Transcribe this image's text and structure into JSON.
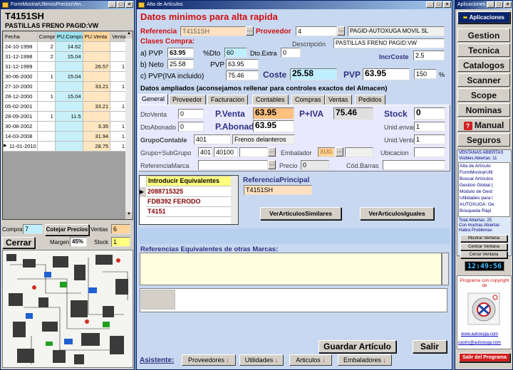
{
  "left": {
    "title": "FormMostrarUltimosPreciosVen...",
    "code": "T4151SH",
    "desc": "PASTILLAS FRENO PAGID:VW",
    "headers": [
      "Fecha",
      "Compr",
      "PU.Compra",
      "PU.Venta",
      "Venta"
    ],
    "rows": [
      [
        "24-10-1998",
        "2",
        "14.62",
        "",
        ""
      ],
      [
        "31-12-1998",
        "2",
        "15.04",
        "",
        ""
      ],
      [
        "31-12-1999",
        "",
        "",
        "26.57",
        "1"
      ],
      [
        "30-06-2000",
        "1",
        "15.04",
        "",
        ""
      ],
      [
        "27-10-2000",
        "",
        "",
        "33.21",
        "1"
      ],
      [
        "28-12-2000",
        "1",
        "15.04",
        "",
        ""
      ],
      [
        "05-02-2001",
        "",
        "",
        "33.21",
        "1"
      ],
      [
        "28-09-2001",
        "1",
        "11.5",
        "",
        ""
      ],
      [
        "30-08-2002",
        "",
        "",
        "3.35",
        "1"
      ],
      [
        "14-03-2008",
        "",
        "",
        "31.94",
        "1"
      ],
      [
        "11-01-2010",
        "",
        "",
        "28.75",
        "1"
      ]
    ],
    "compras_label": "Compras",
    "compras_val": "7",
    "cotejar": "Cotejar Precios",
    "ventas_label": "Ventas",
    "ventas_val": "6",
    "cerrar": "Cerrar",
    "margen_label": "Margen",
    "margen_val": "45%",
    "stock_label": "Stock",
    "stock_val": "1"
  },
  "main": {
    "title": "Alta de Artículos",
    "heading": "Datos minimos para alta rapida",
    "ref_label": "Referencia",
    "ref_val": "T4151SH",
    "prov_label": "Proveedor",
    "prov_val": "4",
    "prov_name": "PAGID-AUTOXUGA MOVIL SL",
    "clases_label": "Clases Compra:",
    "desc_label": "Descripción",
    "desc_val": "PASTILLAS FRENO PAGID:VW",
    "pvp_a_label": "a) PVP",
    "pvp_a_val": "63.95",
    "dto_label": "%Dto",
    "dto_val": "60",
    "dtoextra_label": "Dto.Extra",
    "dtoextra_val": "0",
    "incr_label": "IncrCoste",
    "incr_val": "2.5",
    "neto_label": "b) Neto",
    "neto_val": "25.58",
    "pvp_label": "PVP",
    "pvp_val": "63.95",
    "pvpiva_label": "c) PVP(IVA incluido)",
    "pvpiva_val": "75.46",
    "coste_label": "Coste",
    "coste_val": "25.58",
    "pvp2_label": "PVP",
    "pvp2_val": "63.95",
    "pct_val": "150",
    "pct_sym": "%",
    "ampliados": "Datos ampliados (aconsejamos rellenar para controles exactos del Almacen)",
    "tabs": [
      "General",
      "Proveedor",
      "Facturacion",
      "Contables",
      "Compras",
      "Ventas",
      "Pedidos"
    ],
    "dtoventa_label": "DtoVenta",
    "dtoventa_val": "0",
    "pventa_label": "P.Venta",
    "pventa_val": "63.95",
    "piva_label": "P+IVA",
    "piva_val": "75.46",
    "stock_label": "Stock",
    "stock_val": "0",
    "dtoabon_label": "DtoAbonado",
    "dtoabon_val": "0",
    "pabon_label": "P.Abonad",
    "pabon_val": "63.95",
    "unienv_label": "Unid.envase",
    "unienv_val": "1",
    "grupo_label": "GrupoContable",
    "grupo_val": "401",
    "grupo_name": "Frenos delanteros",
    "univen_label": "Unid.Venta",
    "univen_val": "1",
    "gsub_label": "Grupo+SubGrupo",
    "gsub_a": "401",
    "gsub_b": "40100",
    "embal_label": "Embalador",
    "embal_val": "XUG",
    "ubic_label": "Ubicacion",
    "refmarca_label": "ReferenciaMarca",
    "precio_label": "Precio",
    "precio_val": "0",
    "codbar_label": "Cód.Barras",
    "equiv_header": "Introducir Equivalentes",
    "equiv": [
      "2088715325",
      "FDB392 FERODO",
      "T4151"
    ],
    "refprin_label": "ReferenciaPrincipal",
    "refprin_val": "T4151SH",
    "similares": "VerArticulosSimilares",
    "iguales": "VerArticulosIguales",
    "refeq_label": "Referencias Equivalentes de otras Marcas:",
    "guardar": "Guardar Artículo",
    "salir": "Salir",
    "asistente": "Asistente:",
    "asist": [
      "Proveedores",
      "Utilidades",
      "Articulos",
      "Embaladores"
    ]
  },
  "right": {
    "title": "Aplicaciones",
    "app_btn": "Aplicaciones",
    "nav": [
      "Gestion",
      "Tecnica",
      "Catalogos",
      "Scanner",
      "Scope",
      "Nominas",
      "Manual",
      "Seguros"
    ],
    "ventanas_title": "VENTANAS ABIERTAS",
    "visibles": "Visibles Abiertas: 11",
    "list": [
      "Alta de Artículo",
      "FormMostrarUlti",
      "Buscar Artículos",
      "Gestion Global (",
      "Módulo de Gest",
      "Utilidades para l",
      "AUTOXUGA: Ge",
      "Búsqueda Rápi"
    ],
    "total": "Total Abiertas: 25",
    "muchas": "Con muchas Abiertas",
    "problemas": "Habra Problemas",
    "mostrar": "Mostrar Ventana",
    "centrar": "Centrar Ventana",
    "cerrarv": "Cerrar Ventana",
    "clock": "12:49:56",
    "copyright": "Programa con copyright de",
    "web": "www.autoxuga.com",
    "email": "castro@autoxuga.com",
    "salir": "Salir del Programa"
  }
}
